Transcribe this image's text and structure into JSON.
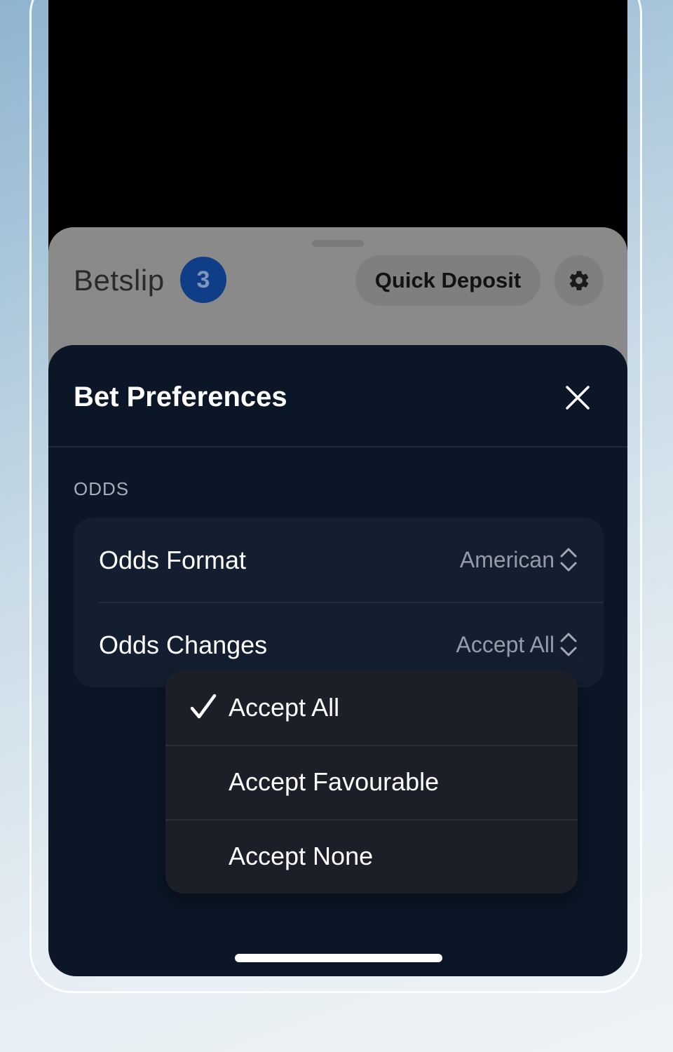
{
  "betslip": {
    "title": "Betslip",
    "count": "3",
    "quick_deposit_label": "Quick Deposit",
    "settings_icon": "gear-icon"
  },
  "preferences": {
    "title": "Bet Preferences",
    "close_icon": "close-icon",
    "section_label": "ODDS",
    "rows": [
      {
        "label": "Odds Format",
        "value": "American"
      },
      {
        "label": "Odds Changes",
        "value": "Accept All"
      }
    ]
  },
  "dropdown": {
    "options": [
      {
        "label": "Accept All",
        "selected": true
      },
      {
        "label": "Accept Favourable",
        "selected": false
      },
      {
        "label": "Accept None",
        "selected": false
      }
    ]
  },
  "colors": {
    "panel_bg": "#0b1727",
    "card_bg": "#131f30",
    "badge_bg": "#103e86",
    "menu_bg": "#1c1f27"
  }
}
